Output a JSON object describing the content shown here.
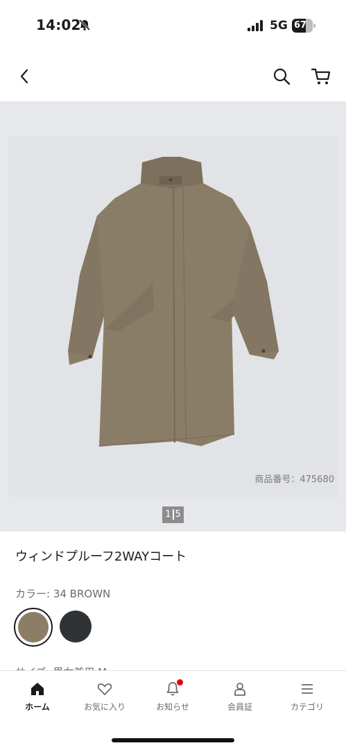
{
  "status_bar": {
    "time": "14:02",
    "network": "5G",
    "battery": "67",
    "battery_level": 0.67
  },
  "header": {
    "back_icon": "chevron-left-icon",
    "search_icon": "search-icon",
    "cart_icon": "cart-icon"
  },
  "gallery": {
    "product_number": "商品番号：475680",
    "pager_current": "1",
    "pager_total": "5",
    "image": "coat-photo"
  },
  "product": {
    "title": "ウィンドプルーフ2WAYコート",
    "color_label": "カラー: 34 BROWN",
    "swatches": [
      {
        "name": "brown",
        "color": "#8c7d67",
        "selected": true
      },
      {
        "name": "dark",
        "color": "#2f3336",
        "selected": false
      }
    ],
    "size_label": "サイズ: 男女兼用 M"
  },
  "bottom_nav": {
    "items": [
      {
        "label": "ホーム",
        "icon": "home-icon",
        "active": true
      },
      {
        "label": "お気に入り",
        "icon": "heart-icon",
        "active": false
      },
      {
        "label": "お知らせ",
        "icon": "bell-icon",
        "active": false,
        "badge": true
      },
      {
        "label": "会員証",
        "icon": "person-icon",
        "active": false
      },
      {
        "label": "カテゴリ",
        "icon": "menu-icon",
        "active": false
      }
    ]
  },
  "colors": {
    "accent_badge": "#e60012",
    "text": "#1b1b1b",
    "muted": "#6b6b6b"
  }
}
